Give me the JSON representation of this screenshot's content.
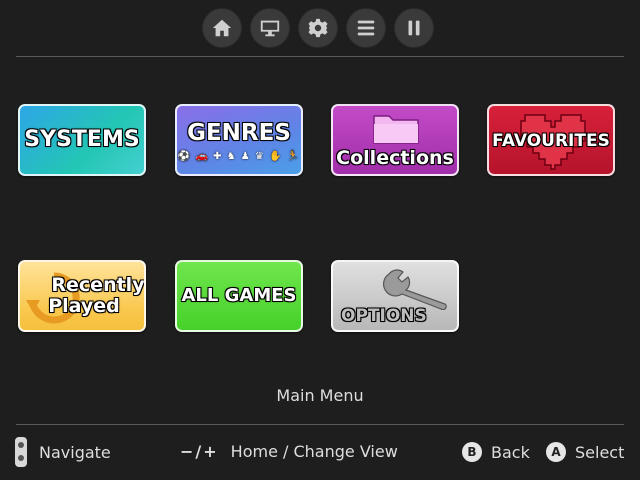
{
  "top_icons": [
    "home-icon",
    "monitor-icon",
    "gear-icon",
    "list-icon",
    "pause-icon"
  ],
  "tiles": {
    "systems": "SYSTEMS",
    "genres": "GENRES",
    "collections": "Collections",
    "favourites": "FAVOURITES",
    "recently_played_line1": "Recently",
    "recently_played_line2": "Played",
    "all_games": "ALL GAMES",
    "options": "OPTIONS"
  },
  "colors": {
    "systems": "#2ea6e6",
    "genres": "#7a78e8",
    "collections": "#b53ab9",
    "favourites": "#c81a33",
    "recently_played": "#f8cd5a",
    "all_games": "#58dc3a",
    "options": "#c8c8c8"
  },
  "menu_title": "Main Menu",
  "footer": {
    "navigate": "Navigate",
    "minus_plus": "−/+",
    "home_change_view": "Home / Change View",
    "b_glyph": "B",
    "back": "Back",
    "a_glyph": "A",
    "select": "Select"
  }
}
